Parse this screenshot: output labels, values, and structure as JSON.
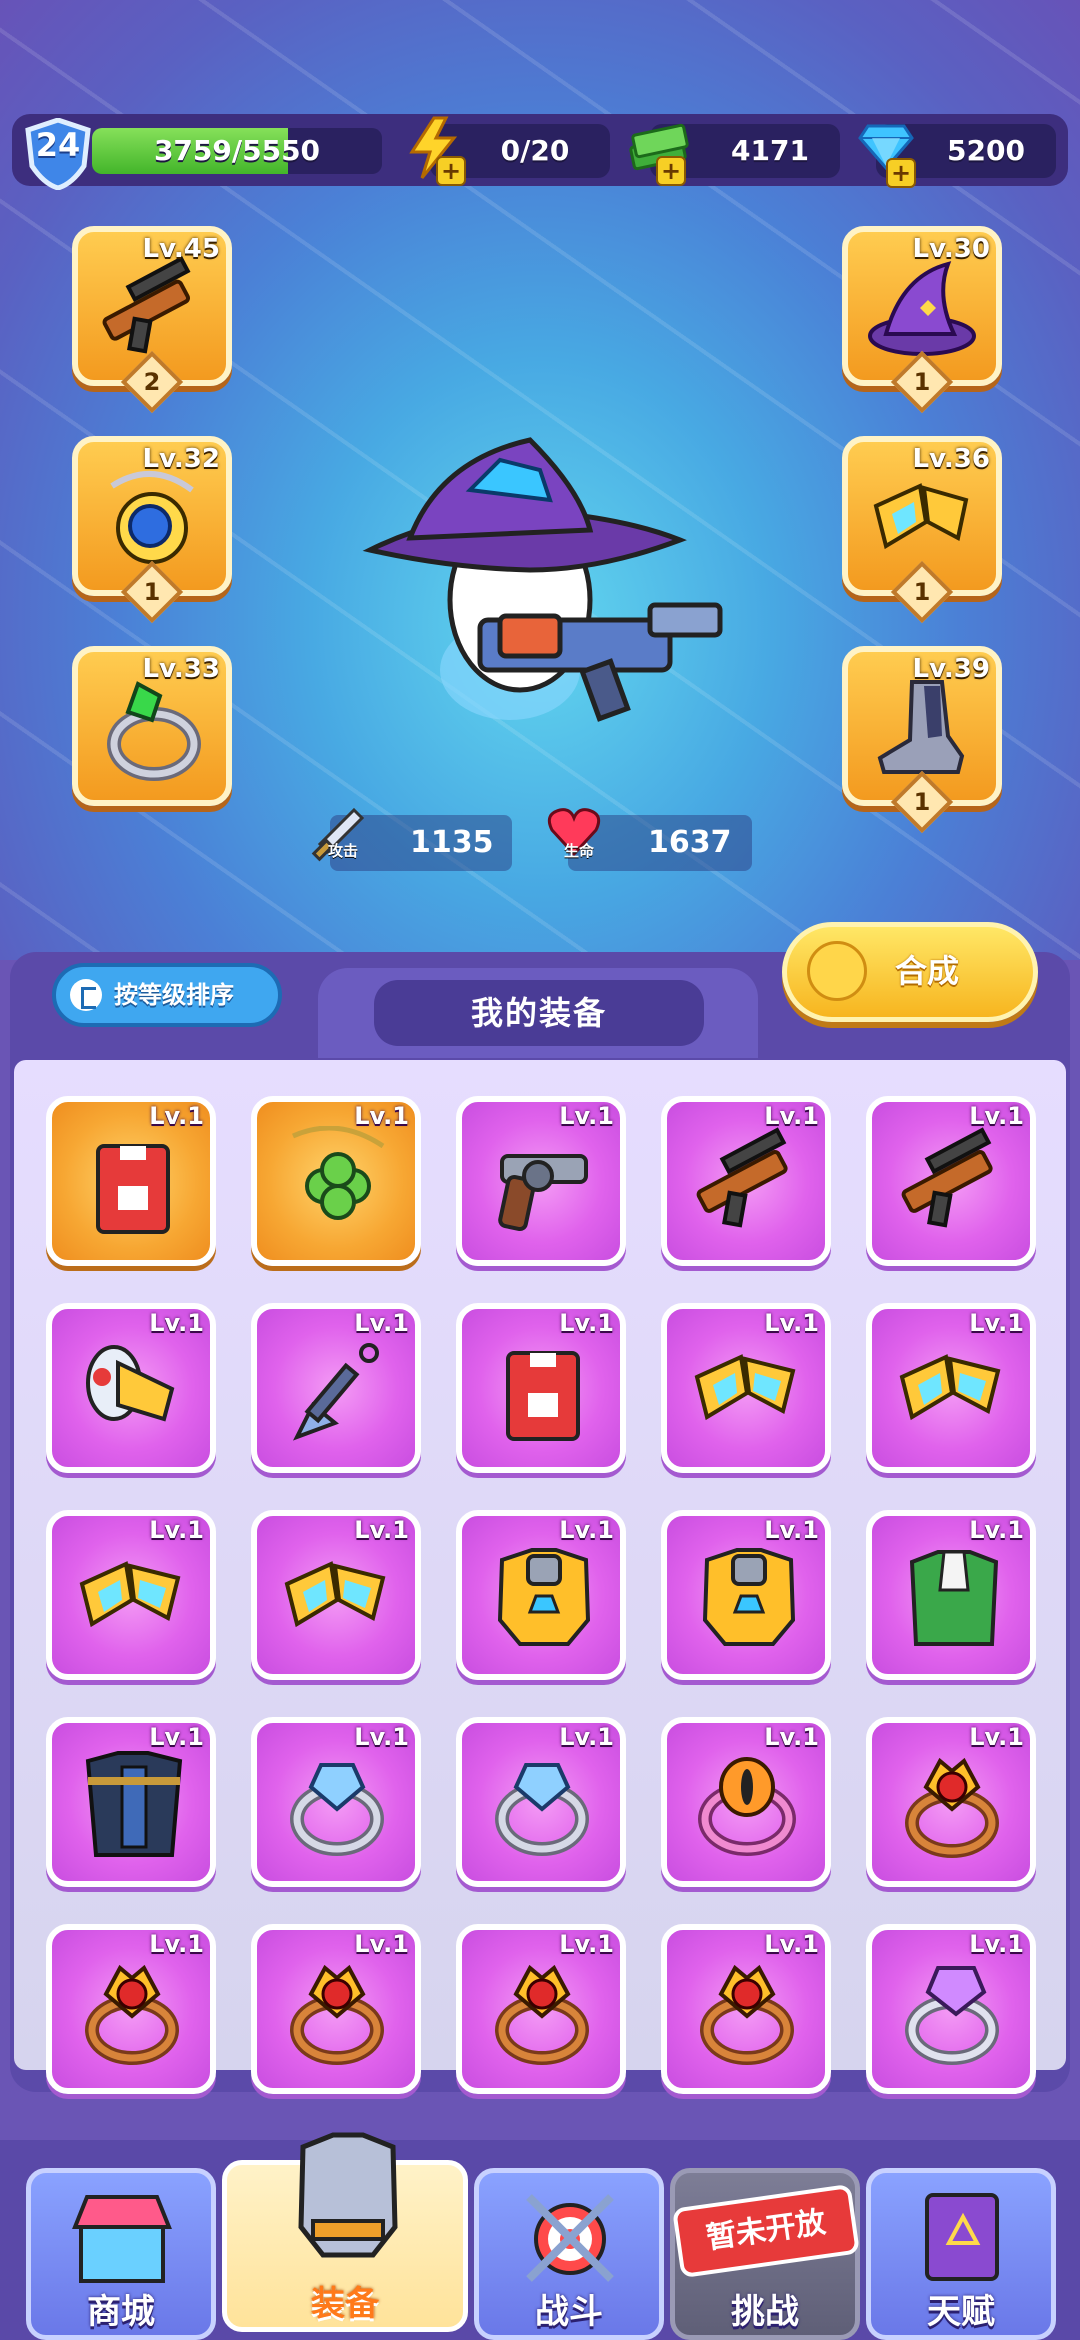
{
  "header": {
    "player_level": "24",
    "xp_text": "3759/5550",
    "xp_fraction": 0.677,
    "energy": "0/20",
    "cash": "4171",
    "gems": "5200"
  },
  "equipped_left": [
    {
      "level": "Lv.45",
      "count": "2",
      "icon": "rifle-icon"
    },
    {
      "level": "Lv.32",
      "count": "1",
      "icon": "amulet-icon"
    },
    {
      "level": "Lv.33",
      "count": null,
      "icon": "ring-icon"
    }
  ],
  "equipped_right": [
    {
      "level": "Lv.30",
      "count": "1",
      "icon": "wizard-hat-icon"
    },
    {
      "level": "Lv.36",
      "count": "1",
      "icon": "goggles-icon"
    },
    {
      "level": "Lv.39",
      "count": "1",
      "icon": "boots-icon"
    }
  ],
  "stats": {
    "attack_value": "1135",
    "attack_label": "攻击",
    "health_value": "1637",
    "health_label": "生命"
  },
  "panel": {
    "sort_label": "按等级排序",
    "title": "我的装备",
    "merge_label": "合成"
  },
  "inventory": [
    {
      "level": "Lv.1",
      "rarity": "orange",
      "icon": "jersey-icon"
    },
    {
      "level": "Lv.1",
      "rarity": "orange",
      "icon": "clover-necklace-icon"
    },
    {
      "level": "Lv.1",
      "rarity": "purple",
      "icon": "revolver-icon"
    },
    {
      "level": "Lv.1",
      "rarity": "purple",
      "icon": "rifle-icon"
    },
    {
      "level": "Lv.1",
      "rarity": "purple",
      "icon": "rifle-icon"
    },
    {
      "level": "Lv.1",
      "rarity": "purple",
      "icon": "megaphone-icon"
    },
    {
      "level": "Lv.1",
      "rarity": "purple",
      "icon": "kunai-icon"
    },
    {
      "level": "Lv.1",
      "rarity": "purple",
      "icon": "jersey-icon"
    },
    {
      "level": "Lv.1",
      "rarity": "purple",
      "icon": "goggles-icon"
    },
    {
      "level": "Lv.1",
      "rarity": "purple",
      "icon": "goggles-icon"
    },
    {
      "level": "Lv.1",
      "rarity": "purple",
      "icon": "goggles-icon"
    },
    {
      "level": "Lv.1",
      "rarity": "purple",
      "icon": "goggles-icon"
    },
    {
      "level": "Lv.1",
      "rarity": "purple",
      "icon": "armor-icon"
    },
    {
      "level": "Lv.1",
      "rarity": "purple",
      "icon": "armor-icon"
    },
    {
      "level": "Lv.1",
      "rarity": "purple",
      "icon": "green-coat-icon"
    },
    {
      "level": "Lv.1",
      "rarity": "purple",
      "icon": "dark-cloak-icon"
    },
    {
      "level": "Lv.1",
      "rarity": "purple",
      "icon": "crystal-ring-icon"
    },
    {
      "level": "Lv.1",
      "rarity": "purple",
      "icon": "crystal-ring-icon"
    },
    {
      "level": "Lv.1",
      "rarity": "purple",
      "icon": "eye-ring-icon"
    },
    {
      "level": "Lv.1",
      "rarity": "purple",
      "icon": "ruby-ring-icon"
    },
    {
      "level": "Lv.1",
      "rarity": "purple",
      "icon": "ruby-ring-icon"
    },
    {
      "level": "Lv.1",
      "rarity": "purple",
      "icon": "ruby-ring-icon"
    },
    {
      "level": "Lv.1",
      "rarity": "purple",
      "icon": "ruby-ring-icon"
    },
    {
      "level": "Lv.1",
      "rarity": "purple",
      "icon": "ruby-ring-icon"
    },
    {
      "level": "Lv.1",
      "rarity": "purple",
      "icon": "amethyst-ring-icon"
    }
  ],
  "nav": {
    "shop": "商城",
    "equipment": "装备",
    "battle": "战斗",
    "challenge": "挑战",
    "challenge_locked": "暂未开放",
    "talent": "天赋"
  },
  "colors": {
    "accent_purple": "#6a55b5",
    "slot_orange": "#f7a733",
    "cell_purple": "#e062ec",
    "xp_green": "#43b52a"
  }
}
